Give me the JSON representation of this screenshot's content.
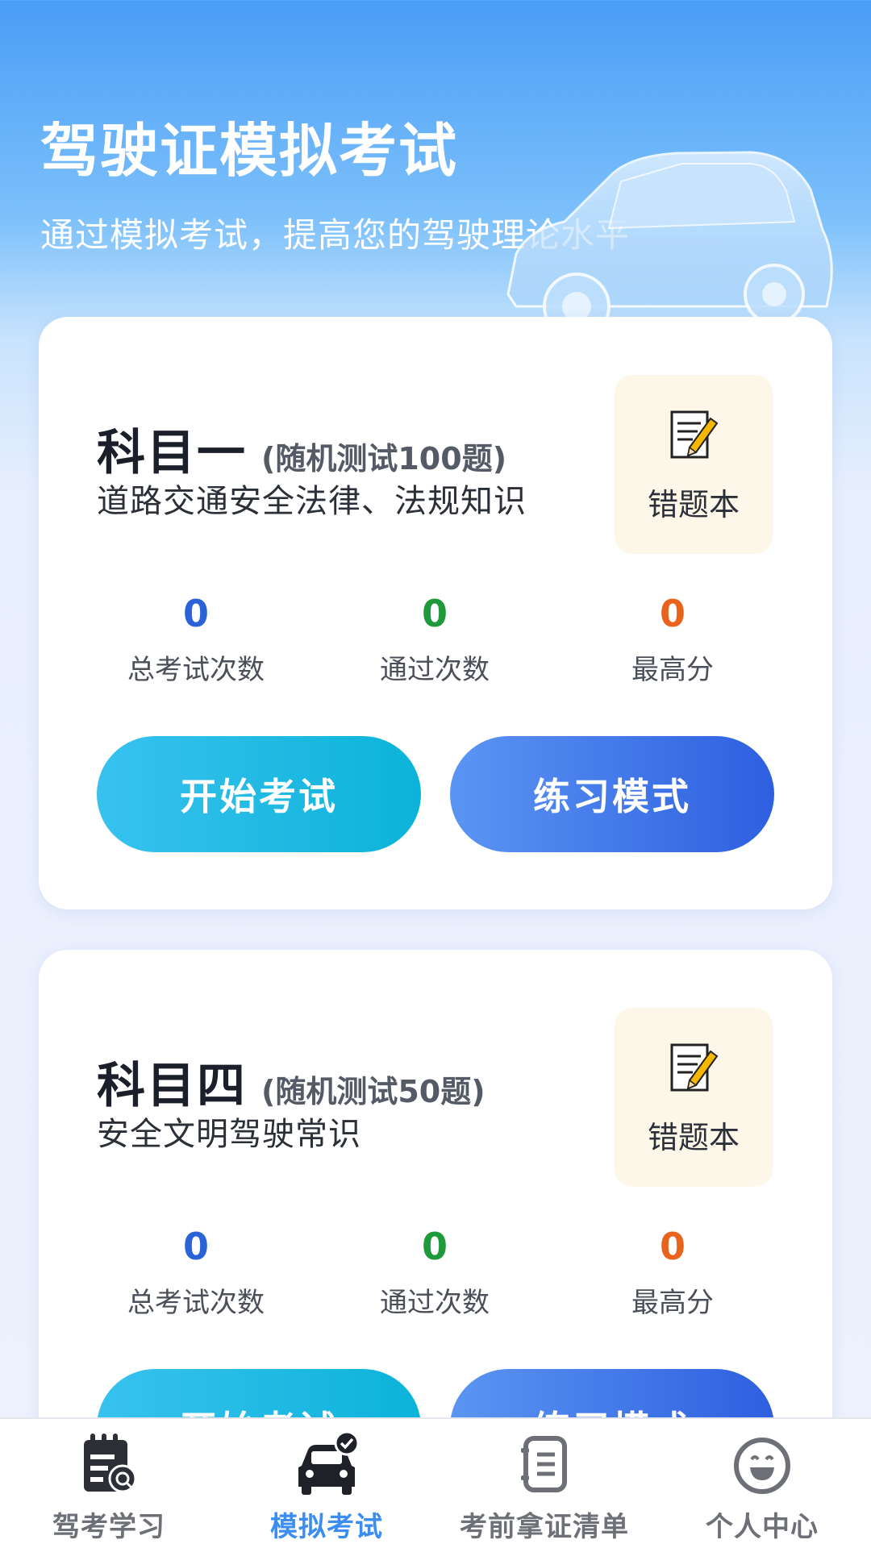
{
  "header": {
    "title": "驾驶证模拟考试",
    "subtitle": "通过模拟考试，提高您的驾驶理论水平"
  },
  "subjects": [
    {
      "name": "科目一",
      "note": "(随机测试100题)",
      "description": "道路交通安全法律、法规知识",
      "wrong_book_label": "错题本",
      "stats": [
        {
          "value": "0",
          "label": "总考试次数",
          "color": "#2a63d6"
        },
        {
          "value": "0",
          "label": "通过次数",
          "color": "#1f9a3a"
        },
        {
          "value": "0",
          "label": "最高分",
          "color": "#e8631e"
        }
      ],
      "start_label": "开始考试",
      "practice_label": "练习模式"
    },
    {
      "name": "科目四",
      "note": "(随机测试50题)",
      "description": "安全文明驾驶常识",
      "wrong_book_label": "错题本",
      "stats": [
        {
          "value": "0",
          "label": "总考试次数",
          "color": "#2a63d6"
        },
        {
          "value": "0",
          "label": "通过次数",
          "color": "#1f9a3a"
        },
        {
          "value": "0",
          "label": "最高分",
          "color": "#e8631e"
        }
      ],
      "start_label": "开始考试",
      "practice_label": "练习模式"
    }
  ],
  "nav": [
    {
      "label": "驾考学习",
      "icon": "study-calendar-icon",
      "active": false
    },
    {
      "label": "模拟考试",
      "icon": "car-check-icon",
      "active": true
    },
    {
      "label": "考前拿证清单",
      "icon": "checklist-icon",
      "active": false
    },
    {
      "label": "个人中心",
      "icon": "smiley-face-icon",
      "active": false
    }
  ],
  "colors": {
    "active_nav": "#3b8ef0",
    "inactive_nav": "#6d7077",
    "start_button": "#0cb3d9",
    "practice_button": "#2e5fe0"
  }
}
